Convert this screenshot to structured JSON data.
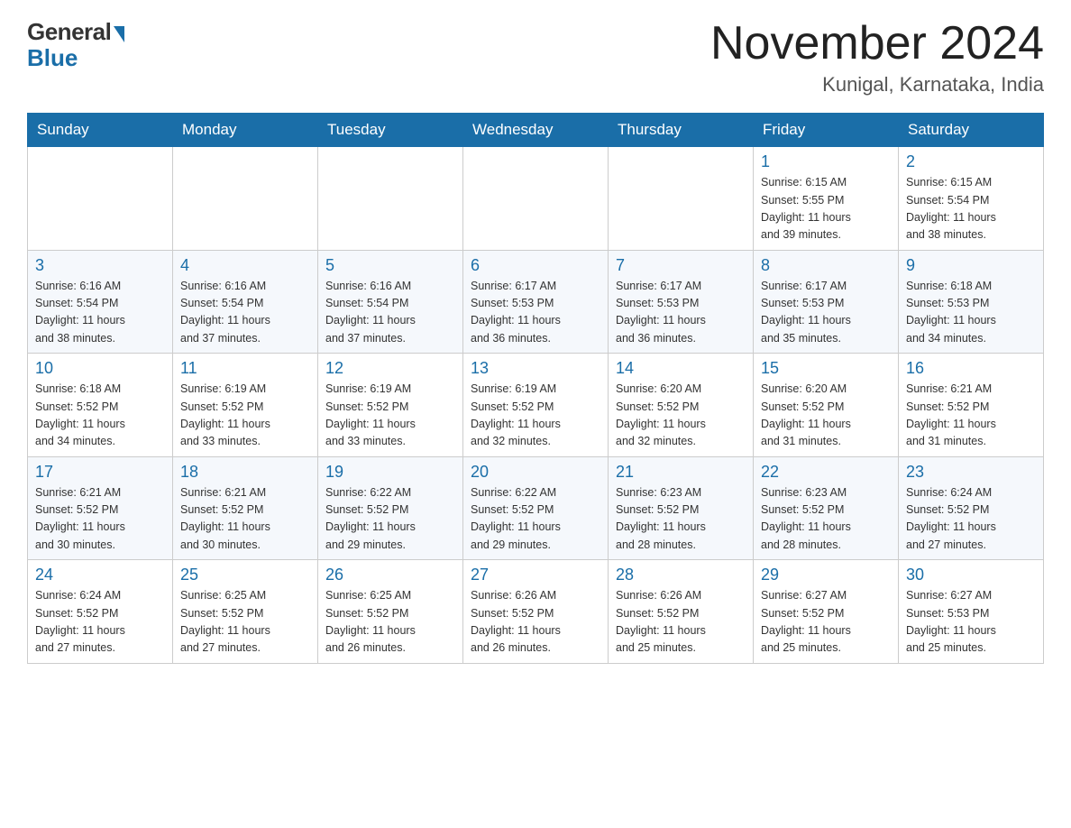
{
  "header": {
    "logo_general": "General",
    "logo_blue": "Blue",
    "month_year": "November 2024",
    "location": "Kunigal, Karnataka, India"
  },
  "days_of_week": [
    "Sunday",
    "Monday",
    "Tuesday",
    "Wednesday",
    "Thursday",
    "Friday",
    "Saturday"
  ],
  "weeks": [
    {
      "days": [
        {
          "number": "",
          "info": ""
        },
        {
          "number": "",
          "info": ""
        },
        {
          "number": "",
          "info": ""
        },
        {
          "number": "",
          "info": ""
        },
        {
          "number": "",
          "info": ""
        },
        {
          "number": "1",
          "info": "Sunrise: 6:15 AM\nSunset: 5:55 PM\nDaylight: 11 hours\nand 39 minutes."
        },
        {
          "number": "2",
          "info": "Sunrise: 6:15 AM\nSunset: 5:54 PM\nDaylight: 11 hours\nand 38 minutes."
        }
      ]
    },
    {
      "days": [
        {
          "number": "3",
          "info": "Sunrise: 6:16 AM\nSunset: 5:54 PM\nDaylight: 11 hours\nand 38 minutes."
        },
        {
          "number": "4",
          "info": "Sunrise: 6:16 AM\nSunset: 5:54 PM\nDaylight: 11 hours\nand 37 minutes."
        },
        {
          "number": "5",
          "info": "Sunrise: 6:16 AM\nSunset: 5:54 PM\nDaylight: 11 hours\nand 37 minutes."
        },
        {
          "number": "6",
          "info": "Sunrise: 6:17 AM\nSunset: 5:53 PM\nDaylight: 11 hours\nand 36 minutes."
        },
        {
          "number": "7",
          "info": "Sunrise: 6:17 AM\nSunset: 5:53 PM\nDaylight: 11 hours\nand 36 minutes."
        },
        {
          "number": "8",
          "info": "Sunrise: 6:17 AM\nSunset: 5:53 PM\nDaylight: 11 hours\nand 35 minutes."
        },
        {
          "number": "9",
          "info": "Sunrise: 6:18 AM\nSunset: 5:53 PM\nDaylight: 11 hours\nand 34 minutes."
        }
      ]
    },
    {
      "days": [
        {
          "number": "10",
          "info": "Sunrise: 6:18 AM\nSunset: 5:52 PM\nDaylight: 11 hours\nand 34 minutes."
        },
        {
          "number": "11",
          "info": "Sunrise: 6:19 AM\nSunset: 5:52 PM\nDaylight: 11 hours\nand 33 minutes."
        },
        {
          "number": "12",
          "info": "Sunrise: 6:19 AM\nSunset: 5:52 PM\nDaylight: 11 hours\nand 33 minutes."
        },
        {
          "number": "13",
          "info": "Sunrise: 6:19 AM\nSunset: 5:52 PM\nDaylight: 11 hours\nand 32 minutes."
        },
        {
          "number": "14",
          "info": "Sunrise: 6:20 AM\nSunset: 5:52 PM\nDaylight: 11 hours\nand 32 minutes."
        },
        {
          "number": "15",
          "info": "Sunrise: 6:20 AM\nSunset: 5:52 PM\nDaylight: 11 hours\nand 31 minutes."
        },
        {
          "number": "16",
          "info": "Sunrise: 6:21 AM\nSunset: 5:52 PM\nDaylight: 11 hours\nand 31 minutes."
        }
      ]
    },
    {
      "days": [
        {
          "number": "17",
          "info": "Sunrise: 6:21 AM\nSunset: 5:52 PM\nDaylight: 11 hours\nand 30 minutes."
        },
        {
          "number": "18",
          "info": "Sunrise: 6:21 AM\nSunset: 5:52 PM\nDaylight: 11 hours\nand 30 minutes."
        },
        {
          "number": "19",
          "info": "Sunrise: 6:22 AM\nSunset: 5:52 PM\nDaylight: 11 hours\nand 29 minutes."
        },
        {
          "number": "20",
          "info": "Sunrise: 6:22 AM\nSunset: 5:52 PM\nDaylight: 11 hours\nand 29 minutes."
        },
        {
          "number": "21",
          "info": "Sunrise: 6:23 AM\nSunset: 5:52 PM\nDaylight: 11 hours\nand 28 minutes."
        },
        {
          "number": "22",
          "info": "Sunrise: 6:23 AM\nSunset: 5:52 PM\nDaylight: 11 hours\nand 28 minutes."
        },
        {
          "number": "23",
          "info": "Sunrise: 6:24 AM\nSunset: 5:52 PM\nDaylight: 11 hours\nand 27 minutes."
        }
      ]
    },
    {
      "days": [
        {
          "number": "24",
          "info": "Sunrise: 6:24 AM\nSunset: 5:52 PM\nDaylight: 11 hours\nand 27 minutes."
        },
        {
          "number": "25",
          "info": "Sunrise: 6:25 AM\nSunset: 5:52 PM\nDaylight: 11 hours\nand 27 minutes."
        },
        {
          "number": "26",
          "info": "Sunrise: 6:25 AM\nSunset: 5:52 PM\nDaylight: 11 hours\nand 26 minutes."
        },
        {
          "number": "27",
          "info": "Sunrise: 6:26 AM\nSunset: 5:52 PM\nDaylight: 11 hours\nand 26 minutes."
        },
        {
          "number": "28",
          "info": "Sunrise: 6:26 AM\nSunset: 5:52 PM\nDaylight: 11 hours\nand 25 minutes."
        },
        {
          "number": "29",
          "info": "Sunrise: 6:27 AM\nSunset: 5:52 PM\nDaylight: 11 hours\nand 25 minutes."
        },
        {
          "number": "30",
          "info": "Sunrise: 6:27 AM\nSunset: 5:53 PM\nDaylight: 11 hours\nand 25 minutes."
        }
      ]
    }
  ],
  "colors": {
    "header_bg": "#1a6ea8",
    "day_number_color": "#1a6ea8",
    "border_color": "#aaa"
  }
}
